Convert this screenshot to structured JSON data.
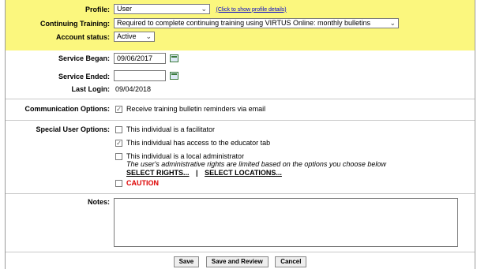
{
  "profile": {
    "label": "Profile:",
    "value": "User",
    "details_link": "(Click to show profile details)"
  },
  "continuing_training": {
    "label": "Continuing Training:",
    "value": "Required to complete continuing training using VIRTUS Online: monthly bulletins"
  },
  "account_status": {
    "label": "Account status:",
    "value": "Active"
  },
  "service_began": {
    "label": "Service Began:",
    "value": "09/06/2017"
  },
  "service_ended": {
    "label": "Service Ended:",
    "value": ""
  },
  "last_login": {
    "label": "Last Login:",
    "value": "09/04/2018"
  },
  "communication": {
    "label": "Communication Options:",
    "option": "Receive training bulletin reminders via email",
    "checked": true
  },
  "special": {
    "label": "Special User Options:",
    "facilitator": "This individual is a facilitator",
    "educator": "This individual has access to the educator tab",
    "local_admin": "This individual is a local administrator",
    "admin_note": "The user's administrative rights are limited based on the options you choose below",
    "select_rights": "SELECT RIGHTS...",
    "divider": "|",
    "select_locations": "SELECT LOCATIONS...",
    "caution": "CAUTION"
  },
  "notes": {
    "label": "Notes:",
    "value": ""
  },
  "buttons": {
    "save": "Save",
    "save_review": "Save and Review",
    "cancel": "Cancel"
  },
  "colors": {
    "highlight": "#fbf77e",
    "caution": "#dd0000"
  }
}
